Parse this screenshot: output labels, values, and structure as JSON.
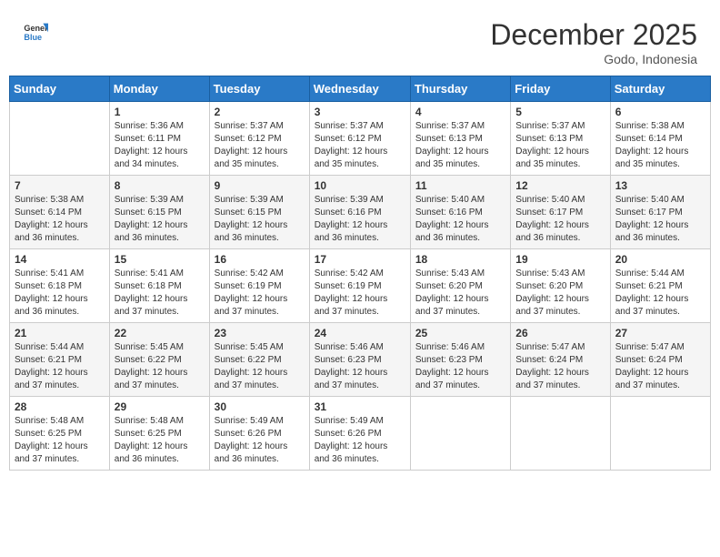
{
  "header": {
    "logo_line1": "General",
    "logo_line2": "Blue",
    "month_title": "December 2025",
    "location": "Godo, Indonesia"
  },
  "weekdays": [
    "Sunday",
    "Monday",
    "Tuesday",
    "Wednesday",
    "Thursday",
    "Friday",
    "Saturday"
  ],
  "weeks": [
    [
      {
        "day": "",
        "info": ""
      },
      {
        "day": "1",
        "info": "Sunrise: 5:36 AM\nSunset: 6:11 PM\nDaylight: 12 hours\nand 34 minutes."
      },
      {
        "day": "2",
        "info": "Sunrise: 5:37 AM\nSunset: 6:12 PM\nDaylight: 12 hours\nand 35 minutes."
      },
      {
        "day": "3",
        "info": "Sunrise: 5:37 AM\nSunset: 6:12 PM\nDaylight: 12 hours\nand 35 minutes."
      },
      {
        "day": "4",
        "info": "Sunrise: 5:37 AM\nSunset: 6:13 PM\nDaylight: 12 hours\nand 35 minutes."
      },
      {
        "day": "5",
        "info": "Sunrise: 5:37 AM\nSunset: 6:13 PM\nDaylight: 12 hours\nand 35 minutes."
      },
      {
        "day": "6",
        "info": "Sunrise: 5:38 AM\nSunset: 6:14 PM\nDaylight: 12 hours\nand 35 minutes."
      }
    ],
    [
      {
        "day": "7",
        "info": "Sunrise: 5:38 AM\nSunset: 6:14 PM\nDaylight: 12 hours\nand 36 minutes."
      },
      {
        "day": "8",
        "info": "Sunrise: 5:39 AM\nSunset: 6:15 PM\nDaylight: 12 hours\nand 36 minutes."
      },
      {
        "day": "9",
        "info": "Sunrise: 5:39 AM\nSunset: 6:15 PM\nDaylight: 12 hours\nand 36 minutes."
      },
      {
        "day": "10",
        "info": "Sunrise: 5:39 AM\nSunset: 6:16 PM\nDaylight: 12 hours\nand 36 minutes."
      },
      {
        "day": "11",
        "info": "Sunrise: 5:40 AM\nSunset: 6:16 PM\nDaylight: 12 hours\nand 36 minutes."
      },
      {
        "day": "12",
        "info": "Sunrise: 5:40 AM\nSunset: 6:17 PM\nDaylight: 12 hours\nand 36 minutes."
      },
      {
        "day": "13",
        "info": "Sunrise: 5:40 AM\nSunset: 6:17 PM\nDaylight: 12 hours\nand 36 minutes."
      }
    ],
    [
      {
        "day": "14",
        "info": "Sunrise: 5:41 AM\nSunset: 6:18 PM\nDaylight: 12 hours\nand 36 minutes."
      },
      {
        "day": "15",
        "info": "Sunrise: 5:41 AM\nSunset: 6:18 PM\nDaylight: 12 hours\nand 37 minutes."
      },
      {
        "day": "16",
        "info": "Sunrise: 5:42 AM\nSunset: 6:19 PM\nDaylight: 12 hours\nand 37 minutes."
      },
      {
        "day": "17",
        "info": "Sunrise: 5:42 AM\nSunset: 6:19 PM\nDaylight: 12 hours\nand 37 minutes."
      },
      {
        "day": "18",
        "info": "Sunrise: 5:43 AM\nSunset: 6:20 PM\nDaylight: 12 hours\nand 37 minutes."
      },
      {
        "day": "19",
        "info": "Sunrise: 5:43 AM\nSunset: 6:20 PM\nDaylight: 12 hours\nand 37 minutes."
      },
      {
        "day": "20",
        "info": "Sunrise: 5:44 AM\nSunset: 6:21 PM\nDaylight: 12 hours\nand 37 minutes."
      }
    ],
    [
      {
        "day": "21",
        "info": "Sunrise: 5:44 AM\nSunset: 6:21 PM\nDaylight: 12 hours\nand 37 minutes."
      },
      {
        "day": "22",
        "info": "Sunrise: 5:45 AM\nSunset: 6:22 PM\nDaylight: 12 hours\nand 37 minutes."
      },
      {
        "day": "23",
        "info": "Sunrise: 5:45 AM\nSunset: 6:22 PM\nDaylight: 12 hours\nand 37 minutes."
      },
      {
        "day": "24",
        "info": "Sunrise: 5:46 AM\nSunset: 6:23 PM\nDaylight: 12 hours\nand 37 minutes."
      },
      {
        "day": "25",
        "info": "Sunrise: 5:46 AM\nSunset: 6:23 PM\nDaylight: 12 hours\nand 37 minutes."
      },
      {
        "day": "26",
        "info": "Sunrise: 5:47 AM\nSunset: 6:24 PM\nDaylight: 12 hours\nand 37 minutes."
      },
      {
        "day": "27",
        "info": "Sunrise: 5:47 AM\nSunset: 6:24 PM\nDaylight: 12 hours\nand 37 minutes."
      }
    ],
    [
      {
        "day": "28",
        "info": "Sunrise: 5:48 AM\nSunset: 6:25 PM\nDaylight: 12 hours\nand 37 minutes."
      },
      {
        "day": "29",
        "info": "Sunrise: 5:48 AM\nSunset: 6:25 PM\nDaylight: 12 hours\nand 36 minutes."
      },
      {
        "day": "30",
        "info": "Sunrise: 5:49 AM\nSunset: 6:26 PM\nDaylight: 12 hours\nand 36 minutes."
      },
      {
        "day": "31",
        "info": "Sunrise: 5:49 AM\nSunset: 6:26 PM\nDaylight: 12 hours\nand 36 minutes."
      },
      {
        "day": "",
        "info": ""
      },
      {
        "day": "",
        "info": ""
      },
      {
        "day": "",
        "info": ""
      }
    ]
  ]
}
